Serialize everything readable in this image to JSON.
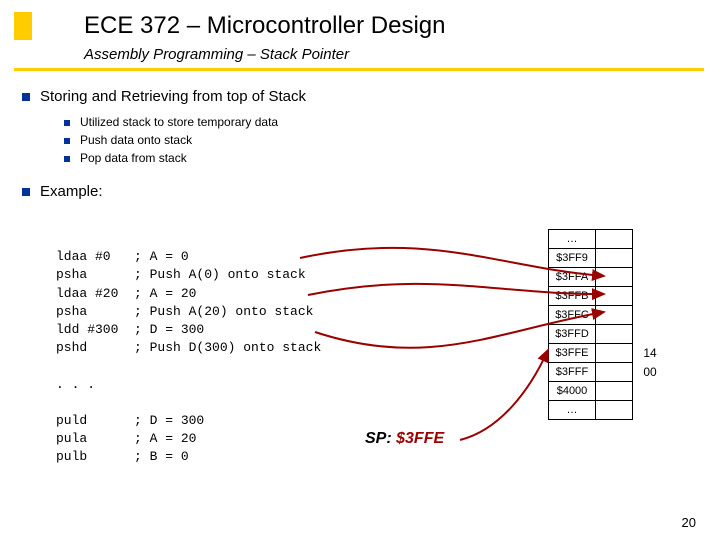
{
  "title": "ECE 372 – Microcontroller Design",
  "subtitle": "Assembly Programming – Stack Pointer",
  "bullets": {
    "main": "Storing and Retrieving from top of Stack",
    "subs": [
      "Utilized stack to store temporary data",
      "Push data onto stack",
      "Pop data from stack"
    ],
    "example": "Example:"
  },
  "code": {
    "l1": "ldaa #0   ; A = 0",
    "l2": "psha      ; Push A(0) onto stack",
    "l3": "ldaa #20  ; A = 20",
    "l4": "psha      ; Push A(20) onto stack",
    "l5": "ldd #300  ; D = 300",
    "l6": "pshd      ; Push D(300) onto stack",
    "l7": ". . .",
    "l8": "puld      ; D = 300",
    "l9": "pula      ; A = 20",
    "l10": "pulb      ; B = 0"
  },
  "stack": {
    "rows": [
      {
        "addr": "…",
        "val": ""
      },
      {
        "addr": "$3FF9",
        "val": ""
      },
      {
        "addr": "$3FFA",
        "val": ""
      },
      {
        "addr": "$3FFB",
        "val": ""
      },
      {
        "addr": "$3FFC",
        "val": ""
      },
      {
        "addr": "$3FFD",
        "val": ""
      },
      {
        "addr": "$3FFE",
        "val": "",
        "side": "14"
      },
      {
        "addr": "$3FFF",
        "val": "",
        "side": "00"
      },
      {
        "addr": "$4000",
        "val": ""
      },
      {
        "addr": "…",
        "val": ""
      }
    ]
  },
  "sp": {
    "label": "SP:",
    "value": "$3FFE"
  },
  "page": "20"
}
